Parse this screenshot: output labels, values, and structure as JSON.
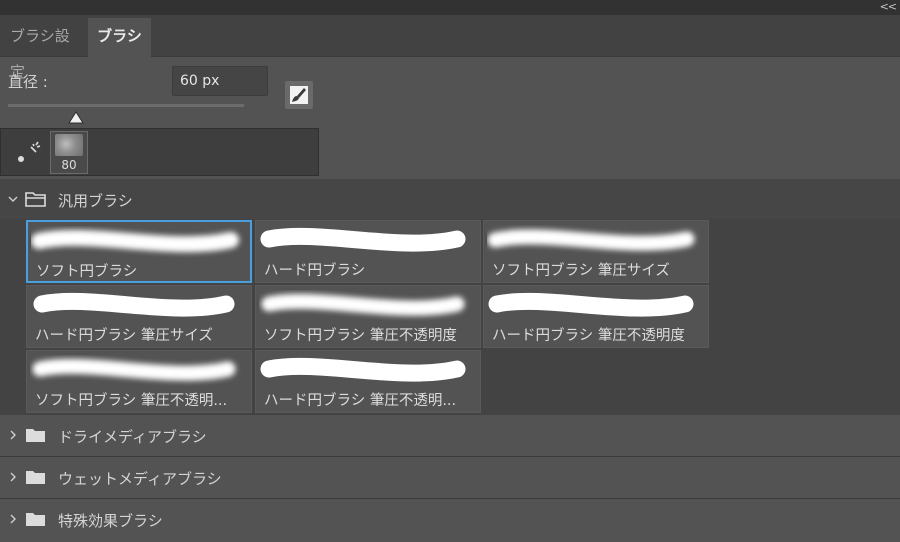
{
  "panel": {
    "collapse_label": "<<",
    "tabs": [
      {
        "label": "ブラシ設定",
        "active": false
      },
      {
        "label": "ブラシ",
        "active": true
      }
    ]
  },
  "diameter": {
    "label": "直径 :",
    "value": "60 px"
  },
  "presets": {
    "recent_size": "80"
  },
  "groups": [
    {
      "label": "汎用ブラシ",
      "expanded": true
    },
    {
      "label": "ドライメディアブラシ",
      "expanded": false
    },
    {
      "label": "ウェットメディアブラシ",
      "expanded": false
    },
    {
      "label": "特殊効果ブラシ",
      "expanded": false
    }
  ],
  "brushes": [
    {
      "name": "ソフト円ブラシ",
      "type": "soft",
      "selected": true
    },
    {
      "name": "ハード円ブラシ",
      "type": "hard",
      "selected": false
    },
    {
      "name": "ソフト円ブラシ 筆圧サイズ",
      "type": "soft",
      "selected": false
    },
    {
      "name": "ハード円ブラシ 筆圧サイズ",
      "type": "hard",
      "selected": false
    },
    {
      "name": "ソフト円ブラシ 筆圧不透明度",
      "type": "soft",
      "selected": false
    },
    {
      "name": "ハード円ブラシ 筆圧不透明度",
      "type": "hard",
      "selected": false
    },
    {
      "name": "ソフト円ブラシ 筆圧不透明...",
      "type": "soft",
      "selected": false
    },
    {
      "name": "ハード円ブラシ 筆圧不透明...",
      "type": "hard",
      "selected": false
    }
  ],
  "colors": {
    "selection": "#4c9fde",
    "panel_bg": "#535353"
  }
}
